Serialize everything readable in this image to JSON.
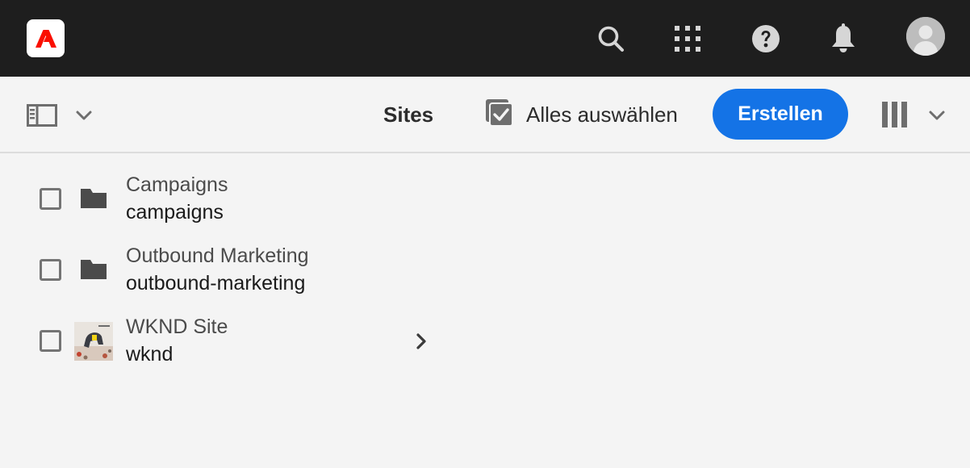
{
  "topbar": {
    "logo_icon": "adobe-logo-icon",
    "icons": [
      "search-icon",
      "apps-grid-icon",
      "help-icon",
      "bell-icon",
      "user-avatar-icon"
    ],
    "brand_color": "#fa0f00"
  },
  "actionbar": {
    "title": "Sites",
    "select_all_label": "Alles auswählen",
    "create_label": "Erstellen",
    "accent_color": "#1473e6"
  },
  "list": {
    "items": [
      {
        "title": "Campaigns",
        "name": "campaigns",
        "type": "folder",
        "has_children": false
      },
      {
        "title": "Outbound Marketing",
        "name": "outbound-marketing",
        "type": "folder",
        "has_children": false
      },
      {
        "title": "WKND Site",
        "name": "wknd",
        "type": "site-thumbnail",
        "has_children": true
      }
    ]
  }
}
